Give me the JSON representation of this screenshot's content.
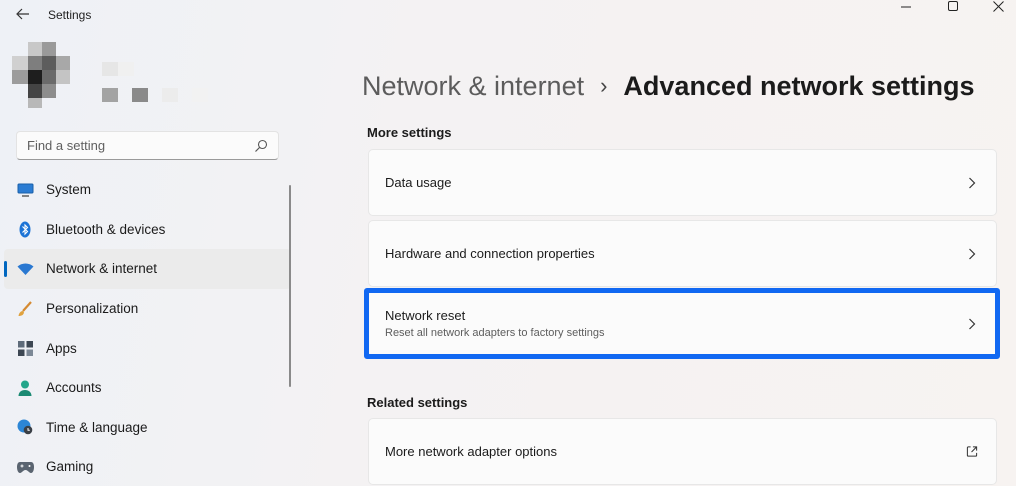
{
  "window": {
    "title": "Settings",
    "back_icon": "back-arrow-icon",
    "controls": [
      "minimize-icon",
      "maximize-icon",
      "close-icon"
    ]
  },
  "search": {
    "placeholder": "Find a setting",
    "value": ""
  },
  "sidebar": {
    "items": [
      {
        "label": "System",
        "icon": "system-display-icon",
        "selected": false
      },
      {
        "label": "Bluetooth & devices",
        "icon": "bluetooth-icon",
        "selected": false
      },
      {
        "label": "Network & internet",
        "icon": "wifi-icon",
        "selected": true
      },
      {
        "label": "Personalization",
        "icon": "brush-icon",
        "selected": false
      },
      {
        "label": "Apps",
        "icon": "apps-icon",
        "selected": false
      },
      {
        "label": "Accounts",
        "icon": "person-icon",
        "selected": false
      },
      {
        "label": "Time & language",
        "icon": "globe-clock-icon",
        "selected": false
      },
      {
        "label": "Gaming",
        "icon": "gamepad-icon",
        "selected": false
      }
    ]
  },
  "breadcrumb": {
    "parent": "Network & internet",
    "separator": "›",
    "current": "Advanced network settings"
  },
  "more_settings": {
    "heading": "More settings",
    "items": [
      {
        "label": "Data usage",
        "sub": ""
      },
      {
        "label": "Hardware and connection properties",
        "sub": ""
      },
      {
        "label": "Network reset",
        "sub": "Reset all network adapters to factory settings",
        "highlighted": true
      }
    ]
  },
  "related_settings": {
    "heading": "Related settings",
    "items": [
      {
        "label": "More network adapter options",
        "icon": "external-link-icon"
      }
    ]
  },
  "colors": {
    "accent": "#0067c0",
    "highlight_border": "#1168f2"
  }
}
